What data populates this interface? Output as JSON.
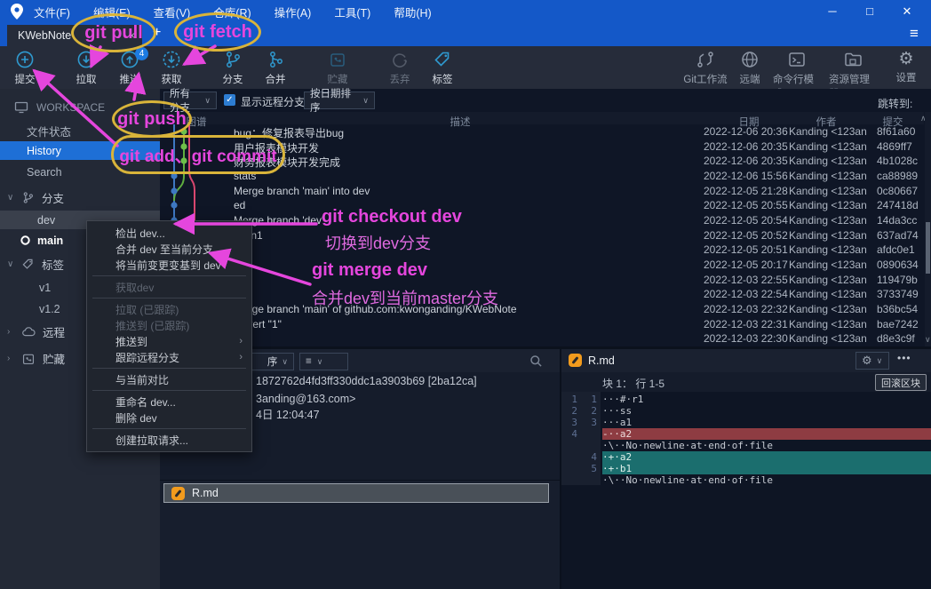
{
  "titlebar": {
    "menus": [
      "文件(F)",
      "编辑(E)",
      "查看(V)",
      "仓库(R)",
      "操作(A)",
      "工具(T)",
      "帮助(H)"
    ],
    "minimize": "─",
    "maximize": "□",
    "close": "✕"
  },
  "tabbar": {
    "tab": "KWebNote",
    "close": "×",
    "new_tab": "+",
    "menu": "≡"
  },
  "toolbar": {
    "buttons": [
      {
        "label": "提交"
      },
      {
        "label": "拉取"
      },
      {
        "label": "推送",
        "badge": "4"
      },
      {
        "label": "获取"
      },
      {
        "label": "分支"
      },
      {
        "label": "合并"
      },
      {
        "label": "贮藏"
      },
      {
        "label": "丢弃"
      },
      {
        "label": "标签"
      }
    ],
    "right_buttons": [
      {
        "label": "Git工作流"
      },
      {
        "label": "远端"
      },
      {
        "label": "命令行模式"
      },
      {
        "label": "资源管理器"
      },
      {
        "label": "设置"
      }
    ]
  },
  "sidebar": {
    "workspace": "WORKSPACE",
    "items": [
      "文件状态",
      "History",
      "Search"
    ],
    "branches_header": "分支",
    "branches": [
      "dev",
      "main"
    ],
    "tags_header": "标签",
    "tags": [
      "v1",
      "v1.2"
    ],
    "remote_header": "远程",
    "stash_header": "贮藏"
  },
  "filter": {
    "branch_filter": "所有分支",
    "show_remote": "显示远程分支",
    "sort": "按日期排序",
    "jump_to": "跳转到:"
  },
  "table": {
    "headers": {
      "graph": "图谱",
      "desc": "描述",
      "date": "日期",
      "author": "作者",
      "commit": "提交"
    },
    "rows": [
      {
        "desc": "bug：修复报表导出bug",
        "date": "2022-12-06 20:36",
        "author": "Kanding <123an",
        "hash": "8f61a60"
      },
      {
        "desc": "用户报表模块开发",
        "date": "2022-12-06 20:35",
        "author": "Kanding <123an",
        "hash": "4869ff7"
      },
      {
        "desc": "财务报表模块开发完成",
        "date": "2022-12-06 20:35",
        "author": "Kanding <123an",
        "hash": "4b1028c"
      },
      {
        "desc": "stats",
        "date": "2022-12-06 15:56",
        "author": "Kanding <123an",
        "hash": "ca88989"
      },
      {
        "desc": "Merge branch 'main' into dev",
        "date": "2022-12-05 21:28",
        "author": "Kanding <123an",
        "hash": "0c80667"
      },
      {
        "desc": "ed",
        "date": "2022-12-05 20:55",
        "author": "Kanding <123an",
        "hash": "247418d"
      },
      {
        "desc": "Merge branch 'dev'",
        "date": "2022-12-05 20:54",
        "author": "Kanding <123an",
        "hash": "14da3cc"
      },
      {
        "desc": "main1",
        "date": "2022-12-05 20:52",
        "author": "Kanding <123an",
        "hash": "637ad74"
      },
      {
        "desc": "",
        "date": "2022-12-05 20:51",
        "author": "Kanding <123an",
        "hash": "afdc0e1"
      },
      {
        "desc": "",
        "date": "2022-12-05 20:17",
        "author": "Kanding <123an",
        "hash": "0890634"
      },
      {
        "desc": "",
        "date": "2022-12-03 22:55",
        "author": "Kanding <123an",
        "hash": "119479b"
      },
      {
        "desc": "",
        "date": "2022-12-03 22:54",
        "author": "Kanding <123an",
        "hash": "3733749"
      },
      {
        "desc": "Merge branch 'main' of github.com:kwonganding/KWebNote",
        "date": "2022-12-03 22:32",
        "author": "Kanding <123an",
        "hash": "b36bc54"
      },
      {
        "desc": "Revert \"1\"",
        "date": "2022-12-03 22:31",
        "author": "Kanding <123an",
        "hash": "bae7242"
      },
      {
        "desc": "",
        "date": "2022-12-03 22:30",
        "author": "Kanding <123an",
        "hash": "d8e3c9f"
      }
    ]
  },
  "context_menu": {
    "items": [
      "检出 dev...",
      "合并 dev 至当前分支",
      "将当前变更变基到 dev",
      "获取dev",
      "拉取 (已跟踪)",
      "推送到 (已跟踪)",
      "推送到",
      "跟踪远程分支",
      "与当前对比",
      "重命名 dev...",
      "删除 dev",
      "创建拉取请求..."
    ]
  },
  "details": {
    "sort_fragment": "序",
    "sha_fragment": "1872762d4fd3ff330ddc1a3903b69 [2ba12ca]",
    "email_fragment": "3anding@163.com>",
    "date_fragment": "4日 12:04:47",
    "file": "R.md"
  },
  "diff": {
    "file": "R.md",
    "hunk": "块 1： 行 1-5",
    "revert": "回滚区块",
    "more": "•••",
    "lines": [
      {
        "old": "1",
        "new": "1",
        "text": "···#·r1",
        "type": "ctx"
      },
      {
        "old": "2",
        "new": "2",
        "text": "···ss",
        "type": "ctx"
      },
      {
        "old": "3",
        "new": "3",
        "text": "···a1",
        "type": "ctx"
      },
      {
        "old": "4",
        "new": "",
        "text": "-··a2",
        "type": "del"
      },
      {
        "old": "",
        "new": "",
        "text": "·\\··No·newline·at·end·of·file",
        "type": "meta"
      },
      {
        "old": "",
        "new": "4",
        "text": "·+·a2",
        "type": "add"
      },
      {
        "old": "",
        "new": "5",
        "text": "·+·b1",
        "type": "add"
      },
      {
        "old": "",
        "new": "",
        "text": "·\\··No·newline·at·end·of·file",
        "type": "meta"
      }
    ]
  },
  "annotations": {
    "pull": "git pull",
    "fetch": "git fetch",
    "push": "git push",
    "add_commit": "git add、git commit",
    "checkout": "git checkout dev",
    "checkout_sub": "切换到dev分支",
    "merge": "git merge dev",
    "merge_sub": "合并dev到当前master分支"
  },
  "colors": {
    "accent_blue": "#1458c8",
    "annotation_magenta": "#e546dd",
    "ellipse_yellow": "#d9b43a",
    "graph_green": "#5fae3f",
    "graph_blue": "#3e78c2",
    "graph_pink": "#d8476f",
    "diff_del_bg": "#8e3c42",
    "diff_add_bg": "#1b6e6e",
    "file_icon_orange": "#f29b1d"
  }
}
